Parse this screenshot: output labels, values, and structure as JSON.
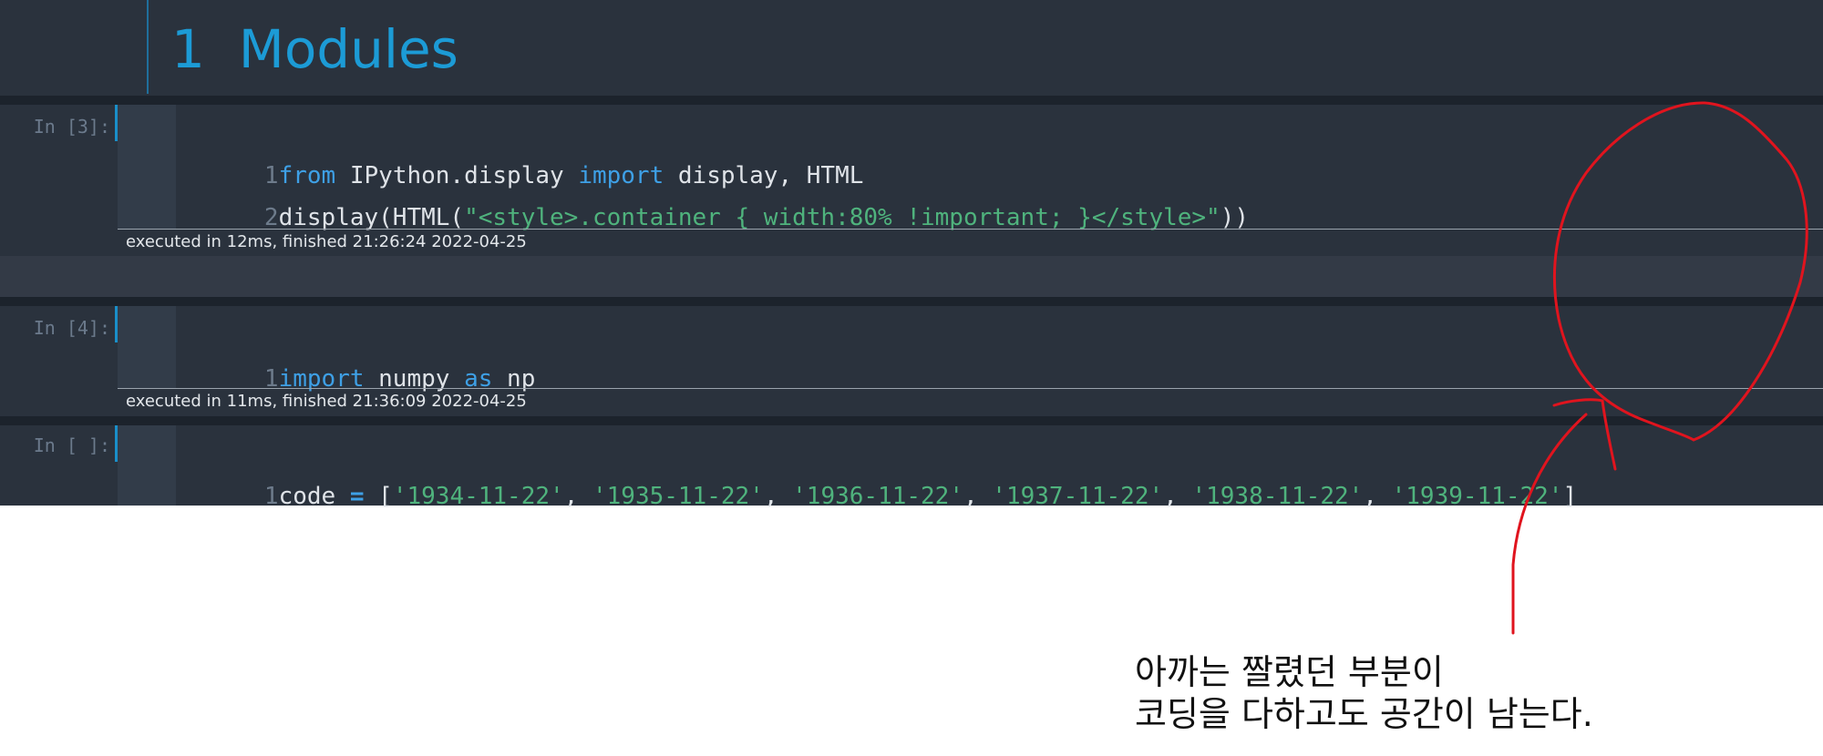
{
  "heading": {
    "text": "1  Modules",
    "color": "#1c9bd6"
  },
  "cells": [
    {
      "prompt": "In [3]:",
      "lines": [
        {
          "num": "1",
          "tokens": [
            {
              "t": "from",
              "c": "kw"
            },
            {
              "t": " IPython.display ",
              "c": ""
            },
            {
              "t": "import",
              "c": "kw"
            },
            {
              "t": " display, HTML",
              "c": ""
            }
          ]
        },
        {
          "num": "2",
          "tokens": [
            {
              "t": "display(HTML(",
              "c": ""
            },
            {
              "t": "\"<style>.container { width:80% !important; }</style>\"",
              "c": "str"
            },
            {
              "t": "))",
              "c": ""
            }
          ]
        }
      ],
      "exec": "executed in 12ms, finished 21:26:24 2022-04-25"
    },
    {
      "prompt": "In [4]:",
      "lines": [
        {
          "num": "1",
          "tokens": [
            {
              "t": "import",
              "c": "kw"
            },
            {
              "t": " numpy ",
              "c": ""
            },
            {
              "t": "as",
              "c": "kw"
            },
            {
              "t": " np",
              "c": ""
            }
          ]
        }
      ],
      "exec": "executed in 11ms, finished 21:36:09 2022-04-25"
    },
    {
      "prompt": "In [ ]:",
      "lines": [
        {
          "num": "1",
          "tokens": [
            {
              "t": "code ",
              "c": ""
            },
            {
              "t": "=",
              "c": "op"
            },
            {
              "t": " [",
              "c": ""
            },
            {
              "t": "'1934-11-22'",
              "c": "str"
            },
            {
              "t": ", ",
              "c": ""
            },
            {
              "t": "'1935-11-22'",
              "c": "str"
            },
            {
              "t": ", ",
              "c": ""
            },
            {
              "t": "'1936-11-22'",
              "c": "str"
            },
            {
              "t": ", ",
              "c": ""
            },
            {
              "t": "'1937-11-22'",
              "c": "str"
            },
            {
              "t": ", ",
              "c": ""
            },
            {
              "t": "'1938-11-22'",
              "c": "str"
            },
            {
              "t": ", ",
              "c": ""
            },
            {
              "t": "'1939-11-22'",
              "c": "str"
            },
            {
              "t": "]",
              "c": ""
            }
          ]
        }
      ],
      "exec": ""
    }
  ],
  "annotation": {
    "line1": "아까는 짤렸던 부분이",
    "line2": "코딩을 다하고도 공간이 남는다.",
    "ink_color": "#e0141e"
  },
  "colors": {
    "notebook_bg": "#2a323d",
    "gutter_bg": "#323c49",
    "keyword": "#3ea0e6",
    "string": "#4fb37d",
    "selection_bar": "#1a8fc9"
  }
}
